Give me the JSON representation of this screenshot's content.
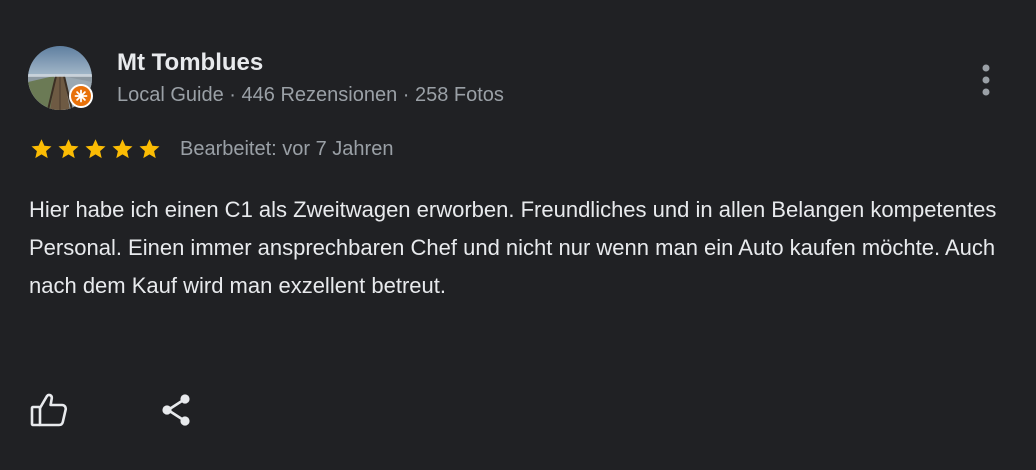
{
  "review": {
    "author": {
      "name": "Mt Tomblues",
      "meta": "Local Guide · 446 Rezensionen · 258 Fotos",
      "badge_icon": "local-guide-badge-icon"
    },
    "rating": {
      "stars": 5,
      "max_stars": 5,
      "star_color": "#fbbc04",
      "edited_text": "Bearbeitet: vor 7 Jahren"
    },
    "text": "Hier habe ich einen C1 als Zweitwagen erworben. Freundliches und in allen Belangen kompetentes Personal. Einen immer ansprechbaren Chef und nicht nur wenn man ein Auto kaufen möchte. Auch nach dem Kauf wird man exzellent betreut.",
    "actions": {
      "like_icon": "thumb-up-icon",
      "share_icon": "share-icon",
      "menu_icon": "more-vert-icon"
    }
  },
  "colors": {
    "background": "#202124",
    "primary_text": "#e8eaed",
    "secondary_text": "#9aa0a6",
    "badge": "#e8710a"
  }
}
